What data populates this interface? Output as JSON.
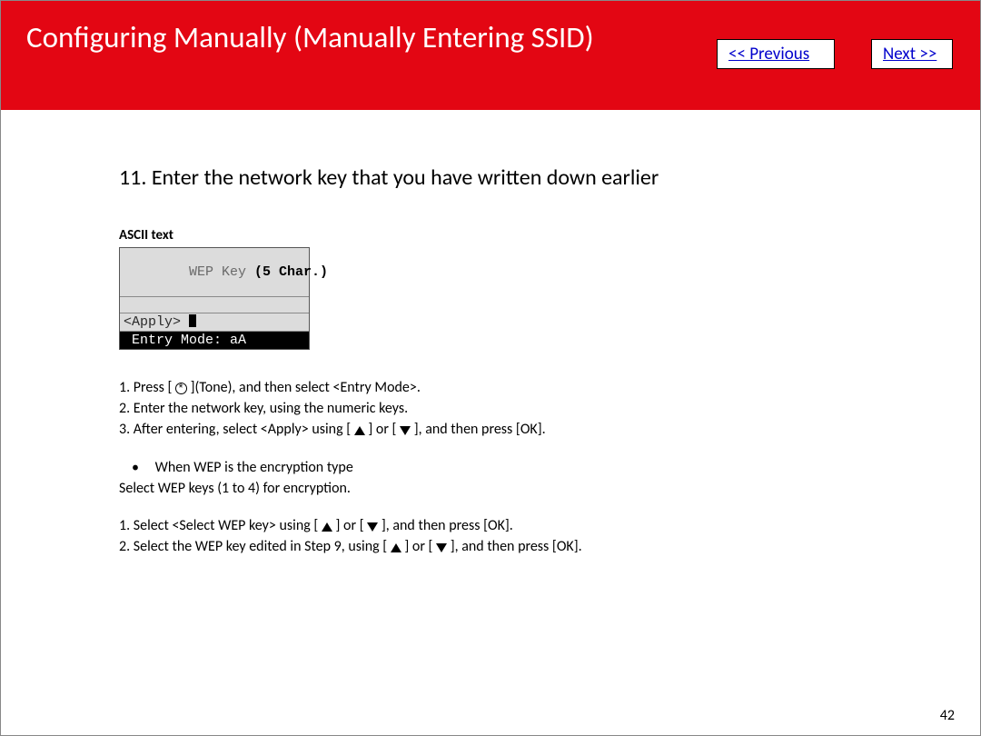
{
  "header": {
    "title": "Configuring Manually (Manually Entering SSID)",
    "prev": " << Previous",
    "next": "Next >>"
  },
  "step": {
    "number": "11.",
    "heading": "Enter the network key that you have written down earlier"
  },
  "lcd_label": "ASCII text",
  "lcd": {
    "line1_a": "WEP Key ",
    "line1_b": "(5 Char.)",
    "apply": "<Apply>",
    "mode": " Entry Mode: aA "
  },
  "instructions": {
    "l1a": "1. Press [ ",
    "l1b": " ](Tone), and then select <Entry Mode>.",
    "l2": "2. Enter the network key, using the numeric keys.",
    "l3a": "3. After entering, select <Apply> using [ ",
    "l3b": " ] or [ ",
    "l3c": " ], and then press [OK].",
    "bullet": "When WEP is the encryption type",
    "sel": "Select WEP keys (1 to 4) for encryption.",
    "w1a": "1. Select <Select WEP key> using [ ",
    "w1b": " ] or [ ",
    "w1c": " ], and then press [OK].",
    "w2a": "2. Select the WEP key edited in Step 9, using [ ",
    "w2b": " ] or [ ",
    "w2c": " ], and then press [OK]."
  },
  "page_number": "42"
}
